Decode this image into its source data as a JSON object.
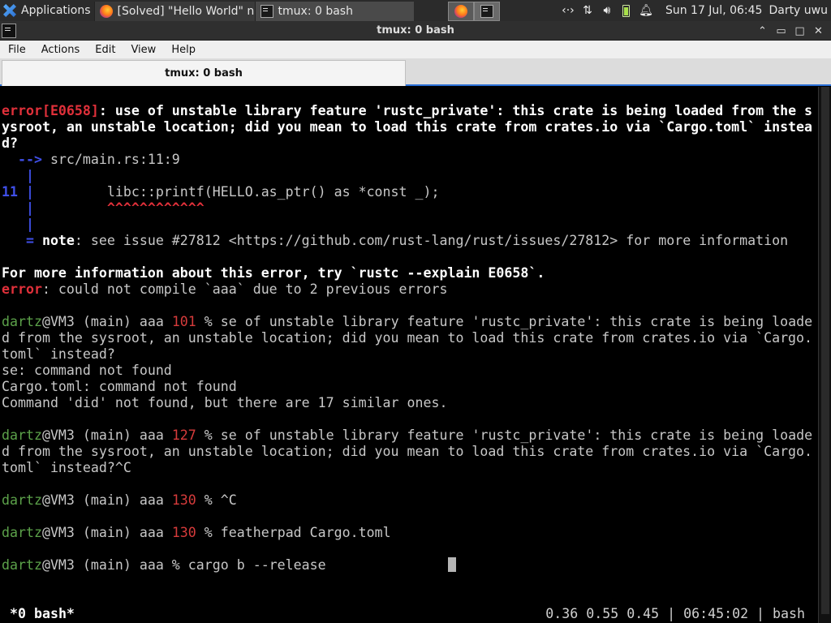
{
  "panel": {
    "applications_label": "Applications",
    "tasks": [
      {
        "label": "[Solved] \"Hello World\" n...",
        "icon": "firefox-icon"
      },
      {
        "label": "tmux: 0 bash",
        "icon": "terminal-icon"
      }
    ],
    "clock": "Sun 17 Jul, 06:45",
    "user": "Darty uwu"
  },
  "window": {
    "title": "tmux: 0 bash",
    "controls": {
      "min": "⌃",
      "restore": "▭",
      "maximize": "□",
      "close": "✕"
    }
  },
  "menubar": [
    "File",
    "Actions",
    "Edit",
    "View",
    "Help"
  ],
  "tab": {
    "label": "tmux: 0 bash"
  },
  "terminal": {
    "lines": [
      [
        {
          "t": "error[E0658]",
          "c": "r"
        },
        {
          "t": ": use of unstable library feature 'rustc_private': this crate is being loaded from the s",
          "c": "w"
        }
      ],
      [
        {
          "t": "ysroot, an unstable location; did you mean to load this crate from crates.io via `Cargo.toml` instea",
          "c": "w"
        }
      ],
      [
        {
          "t": "d?",
          "c": "w"
        }
      ],
      [
        {
          "t": "  -->",
          "c": "b"
        },
        {
          "t": " src/main.rs:11:9",
          "c": "n"
        }
      ],
      [
        {
          "t": "   |",
          "c": "b"
        }
      ],
      [
        {
          "t": "11 |",
          "c": "b"
        },
        {
          "t": "         libc::printf(HELLO.as_ptr() as *const _);",
          "c": "n"
        }
      ],
      [
        {
          "t": "   |",
          "c": "b"
        },
        {
          "t": "         ^^^^^^^^^^^^",
          "c": "r"
        }
      ],
      [
        {
          "t": "   |",
          "c": "b"
        }
      ],
      [
        {
          "t": "   = ",
          "c": "b"
        },
        {
          "t": "note",
          "c": "w"
        },
        {
          "t": ": see issue #27812 <https://github.com/rust-lang/rust/issues/27812> for more information",
          "c": "n"
        }
      ],
      [],
      [
        {
          "t": "For more information about this error, try `rustc --explain E0658`.",
          "c": "w"
        }
      ],
      [
        {
          "t": "error",
          "c": "r"
        },
        {
          "t": ": could not compile `aaa` due to 2 previous errors",
          "c": "n"
        }
      ],
      [],
      [
        {
          "t": "dartz",
          "c": "g"
        },
        {
          "t": "@VM3 (main) aaa ",
          "c": "n"
        },
        {
          "t": "101",
          "c": "rn"
        },
        {
          "t": " % se of unstable library feature 'rustc_private': this crate is being loade",
          "c": "n"
        }
      ],
      [
        {
          "t": "d from the sysroot, an unstable location; did you mean to load this crate from crates.io via `Cargo.",
          "c": "n"
        }
      ],
      [
        {
          "t": "toml` instead?",
          "c": "n"
        }
      ],
      [
        {
          "t": "se: command not found",
          "c": "n"
        }
      ],
      [
        {
          "t": "Cargo.toml: command not found",
          "c": "n"
        }
      ],
      [
        {
          "t": "Command 'did' not found, but there are 17 similar ones.",
          "c": "n"
        }
      ],
      [],
      [
        {
          "t": "dartz",
          "c": "g"
        },
        {
          "t": "@VM3 (main) aaa ",
          "c": "n"
        },
        {
          "t": "127",
          "c": "rn"
        },
        {
          "t": " % se of unstable library feature 'rustc_private': this crate is being loade",
          "c": "n"
        }
      ],
      [
        {
          "t": "d from the sysroot, an unstable location; did you mean to load this crate from crates.io via `Cargo.",
          "c": "n"
        }
      ],
      [
        {
          "t": "toml` instead?^C",
          "c": "n"
        }
      ],
      [],
      [
        {
          "t": "dartz",
          "c": "g"
        },
        {
          "t": "@VM3 (main) aaa ",
          "c": "n"
        },
        {
          "t": "130",
          "c": "rn"
        },
        {
          "t": " % ^C",
          "c": "n"
        }
      ],
      [],
      [
        {
          "t": "dartz",
          "c": "g"
        },
        {
          "t": "@VM3 (main) aaa ",
          "c": "n"
        },
        {
          "t": "130",
          "c": "rn"
        },
        {
          "t": " % featherpad Cargo.toml",
          "c": "n"
        }
      ],
      [],
      [
        {
          "t": "dartz",
          "c": "g"
        },
        {
          "t": "@VM3 (main) aaa % cargo b --release",
          "c": "n"
        }
      ]
    ]
  },
  "tmux_status": {
    "left": "*0 bash*",
    "right": "0.36 0.55 0.45 | 06:45:02 | bash"
  }
}
